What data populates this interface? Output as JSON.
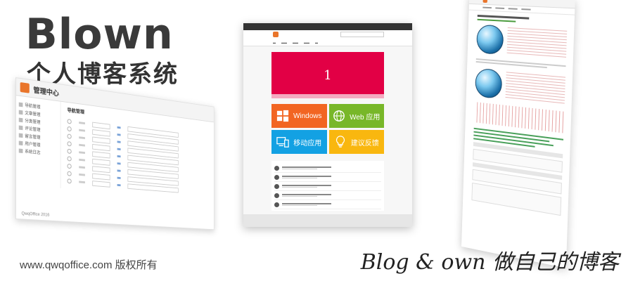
{
  "hero": {
    "title": "Blown",
    "subtitle": "个人博客系统",
    "copyright": "www.qwqoffice.com 版权所有",
    "slogan": "Blog & own 做自己的博客"
  },
  "admin": {
    "header_title": "管理中心",
    "section_title": "导航管理",
    "nav_items": [
      "导航管理",
      "文章管理",
      "分类管理",
      "评论管理",
      "留言管理",
      "用户管理",
      "系统日志"
    ],
    "footer": "QwqOffice 2016"
  },
  "site": {
    "banner_number": "1",
    "tiles": [
      {
        "label": "Windows",
        "icon": "windows-icon"
      },
      {
        "label": "Web 应用",
        "icon": "globe-icon"
      },
      {
        "label": "移动应用",
        "icon": "devices-icon"
      },
      {
        "label": "建议反馈",
        "icon": "lightbulb-icon"
      }
    ],
    "colors": {
      "banner": "#e20045",
      "windows": "#f26522",
      "web": "#78b729",
      "mobile": "#13a1e3",
      "feedback": "#f9b70f"
    }
  }
}
